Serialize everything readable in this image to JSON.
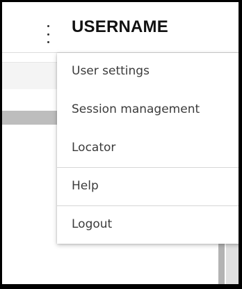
{
  "header": {
    "username": "USERNAME",
    "menu_icon": "kebab-menu-icon"
  },
  "menu": {
    "items": [
      {
        "label": "User settings"
      },
      {
        "label": "Session management"
      },
      {
        "label": "Locator"
      },
      {
        "label": "Help"
      },
      {
        "label": "Logout"
      }
    ]
  },
  "colors": {
    "frame_border": "#000000",
    "menu_text": "#3b3b3b",
    "divider": "#d6d6d6"
  }
}
